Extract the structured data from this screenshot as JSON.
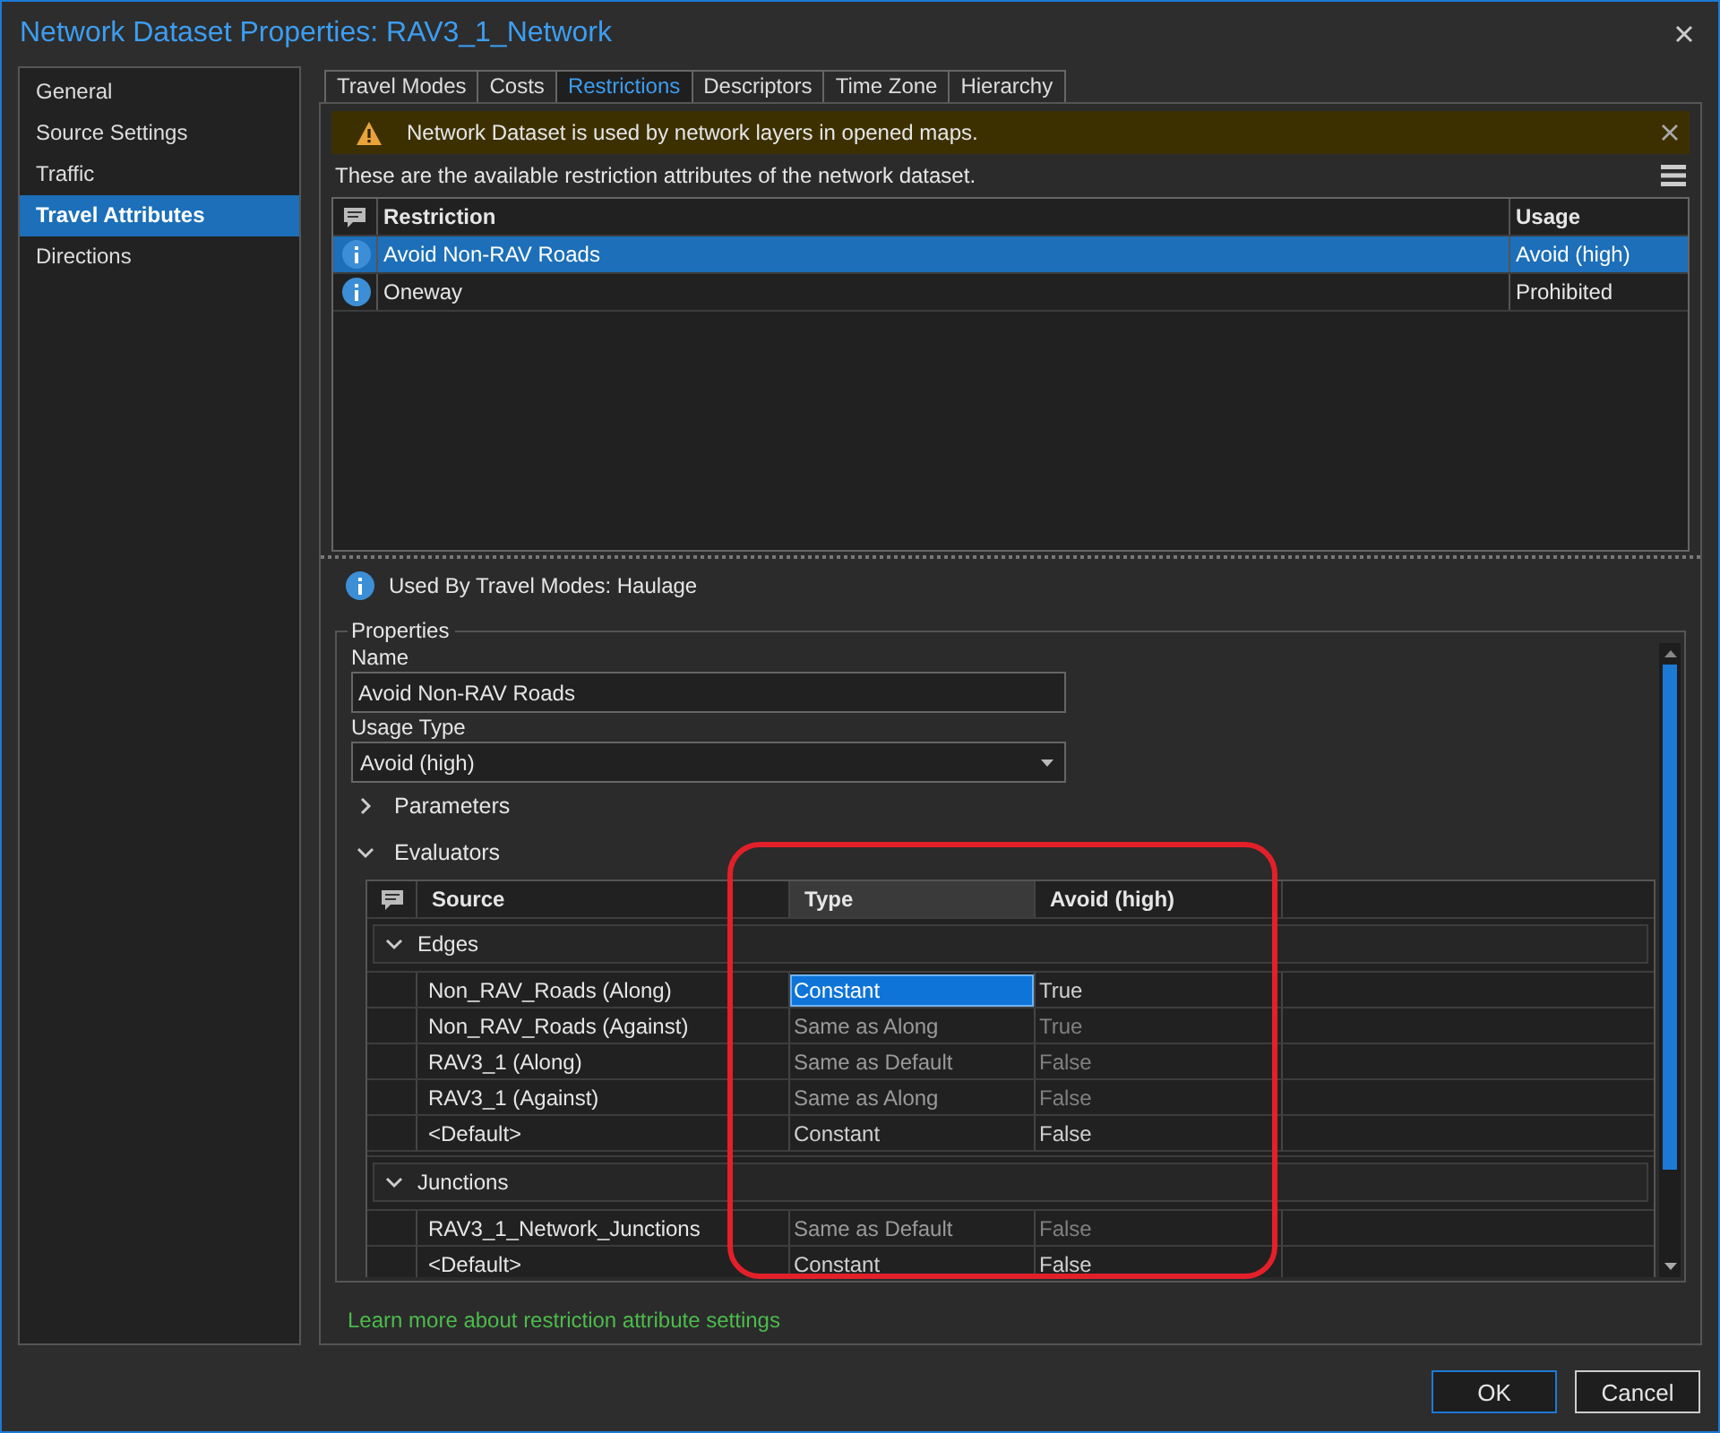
{
  "window": {
    "title": "Network Dataset Properties: RAV3_1_Network"
  },
  "sidebar": {
    "items": [
      {
        "label": "General",
        "selected": false
      },
      {
        "label": "Source Settings",
        "selected": false
      },
      {
        "label": "Traffic",
        "selected": false
      },
      {
        "label": "Travel Attributes",
        "selected": true
      },
      {
        "label": "Directions",
        "selected": false
      }
    ]
  },
  "tabs": [
    {
      "label": "Travel Modes",
      "selected": false
    },
    {
      "label": "Costs",
      "selected": false
    },
    {
      "label": "Restrictions",
      "selected": true
    },
    {
      "label": "Descriptors",
      "selected": false
    },
    {
      "label": "Time Zone",
      "selected": false
    },
    {
      "label": "Hierarchy",
      "selected": false
    }
  ],
  "warning": {
    "text": "Network Dataset is used by network layers in opened maps."
  },
  "description": "These are the available restriction attributes of the network dataset.",
  "restrictions": {
    "columns": [
      "Restriction",
      "Usage"
    ],
    "rows": [
      {
        "name": "Avoid Non-RAV Roads",
        "usage": "Avoid (high)",
        "selected": true
      },
      {
        "name": "Oneway",
        "usage": "Prohibited",
        "selected": false
      }
    ]
  },
  "used_by": "Used By Travel Modes: Haulage",
  "properties": {
    "title": "Properties",
    "name_label": "Name",
    "name_value": "Avoid Non-RAV Roads",
    "usage_type_label": "Usage Type",
    "usage_type_value": "Avoid (high)",
    "sections": [
      {
        "label": "Parameters",
        "expanded": false
      },
      {
        "label": "Evaluators",
        "expanded": true
      }
    ],
    "evaluators": {
      "columns": [
        "Source",
        "Type",
        "Avoid (high)"
      ],
      "groups": [
        {
          "label": "Edges",
          "expanded": true,
          "rows": [
            {
              "source": "Non_RAV_Roads (Along)",
              "type": "Constant",
              "value": "True",
              "selected": true,
              "dimmed": false
            },
            {
              "source": "Non_RAV_Roads (Against)",
              "type": "Same as Along",
              "value": "True",
              "selected": false,
              "dimmed": true
            },
            {
              "source": "RAV3_1 (Along)",
              "type": "Same as Default",
              "value": "False",
              "selected": false,
              "dimmed": true
            },
            {
              "source": "RAV3_1 (Against)",
              "type": "Same as Along",
              "value": "False",
              "selected": false,
              "dimmed": true
            },
            {
              "source": "<Default>",
              "type": "Constant",
              "value": "False",
              "selected": false,
              "dimmed": false
            }
          ]
        },
        {
          "label": "Junctions",
          "expanded": true,
          "rows": [
            {
              "source": "RAV3_1_Network_Junctions",
              "type": "Same as Default",
              "value": "False",
              "selected": false,
              "dimmed": true
            },
            {
              "source": "<Default>",
              "type": "Constant",
              "value": "False",
              "selected": false,
              "dimmed": false
            }
          ]
        }
      ]
    }
  },
  "link": "Learn more about restriction attribute settings",
  "buttons": [
    {
      "label": "OK",
      "default": true
    },
    {
      "label": "Cancel",
      "default": false
    }
  ]
}
